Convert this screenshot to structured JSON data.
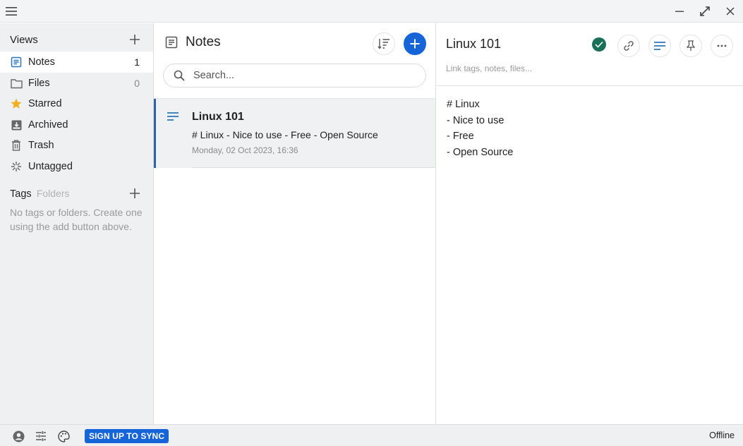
{
  "titlebar": {
    "menu_icon": "hamburger-menu-icon",
    "window_controls": [
      "minimize-icon",
      "maximize-icon",
      "close-icon"
    ]
  },
  "sidebar": {
    "views_heading": "Views",
    "items": [
      {
        "label": "Notes",
        "count": "1",
        "icon": "notes-icon",
        "active": true
      },
      {
        "label": "Files",
        "count": "0",
        "icon": "folder-icon",
        "active": false
      },
      {
        "label": "Starred",
        "count": "",
        "icon": "star-icon",
        "active": false
      },
      {
        "label": "Archived",
        "count": "",
        "icon": "archive-icon",
        "active": false
      },
      {
        "label": "Trash",
        "count": "",
        "icon": "trash-icon",
        "active": false
      },
      {
        "label": "Untagged",
        "count": "",
        "icon": "untagged-icon",
        "active": false
      }
    ],
    "tags_heading": "Tags",
    "folders_heading": "Folders",
    "tags_empty_text": "No tags or folders. Create one using the add button above."
  },
  "note_list": {
    "title": "Notes",
    "search_placeholder": "Search...",
    "notes": [
      {
        "title": "Linux 101",
        "preview": "# Linux - Nice to use - Free - Open Source",
        "date": "Monday, 02 Oct 2023, 16:36"
      }
    ]
  },
  "editor": {
    "title": "Linux 101",
    "links_placeholder": "Link tags, notes, files...",
    "body_lines": [
      "# Linux",
      "- Nice to use",
      "- Free",
      "- Open Source"
    ],
    "saved_status": "saved"
  },
  "statusbar": {
    "sync_label": "SIGN UP TO SYNC",
    "status": "Offline"
  },
  "colors": {
    "accent": "#1565d8",
    "saved_green": "#187157",
    "selected_border": "#2f62a6",
    "star": "#f2b01e"
  }
}
